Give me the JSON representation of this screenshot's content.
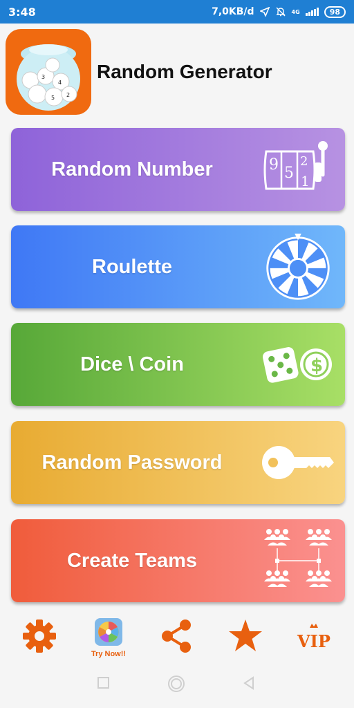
{
  "status_bar": {
    "time": "3:48",
    "net_speed": "7,0KB/d",
    "network": "4G",
    "battery": "98"
  },
  "header": {
    "title": "Random Generator",
    "icon": "lottery-balls-icon"
  },
  "menu": [
    {
      "label": "Random Number",
      "icon": "slot-machine-icon",
      "slot_digits": [
        "9",
        "5",
        "2",
        "1"
      ]
    },
    {
      "label": "Roulette",
      "icon": "wheel-icon"
    },
    {
      "label": "Dice \\ Coin",
      "icon": "dice-coin-icon",
      "coin_symbol": "$"
    },
    {
      "label": "Random Password",
      "icon": "key-icon"
    },
    {
      "label": "Create Teams",
      "icon": "teams-icon"
    }
  ],
  "toolbar": {
    "try_now": "Try Now!!",
    "vip": "VIP"
  },
  "colors": {
    "status_bar": "#1f7fd3",
    "accent": "#e8600f",
    "card_random_number": [
      "#8e63d9",
      "#b792e2"
    ],
    "card_roulette": [
      "#3f78f5",
      "#70b7fa"
    ],
    "card_dice_coin": [
      "#57a838",
      "#a8df66"
    ],
    "card_password": [
      "#e8ab32",
      "#f8d47f"
    ],
    "card_teams": [
      "#f05c3b",
      "#fb9190"
    ]
  }
}
